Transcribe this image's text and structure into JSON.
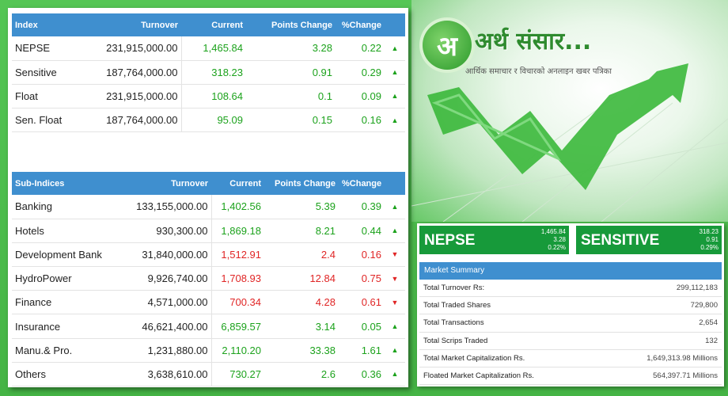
{
  "index_table": {
    "headers": [
      "Index",
      "Turnover",
      "Current",
      "Points Change",
      "%Change"
    ],
    "rows": [
      {
        "name": "NEPSE",
        "turnover": "231,915,000.00",
        "current": "1,465.84",
        "points": "3.28",
        "pct": "0.22",
        "dir": "up"
      },
      {
        "name": "Sensitive",
        "turnover": "187,764,000.00",
        "current": "318.23",
        "points": "0.91",
        "pct": "0.29",
        "dir": "up"
      },
      {
        "name": "Float",
        "turnover": "231,915,000.00",
        "current": "108.64",
        "points": "0.1",
        "pct": "0.09",
        "dir": "up"
      },
      {
        "name": "Sen. Float",
        "turnover": "187,764,000.00",
        "current": "95.09",
        "points": "0.15",
        "pct": "0.16",
        "dir": "up"
      }
    ]
  },
  "sub_table": {
    "headers": [
      "Sub-Indices",
      "Turnover",
      "Current",
      "Points Change",
      "%Change"
    ],
    "rows": [
      {
        "name": "Banking",
        "turnover": "133,155,000.00",
        "current": "1,402.56",
        "points": "5.39",
        "pct": "0.39",
        "dir": "up"
      },
      {
        "name": "Hotels",
        "turnover": "930,300.00",
        "current": "1,869.18",
        "points": "8.21",
        "pct": "0.44",
        "dir": "up"
      },
      {
        "name": "Development Bank",
        "turnover": "31,840,000.00",
        "current": "1,512.91",
        "points": "2.4",
        "pct": "0.16",
        "dir": "down"
      },
      {
        "name": "HydroPower",
        "turnover": "9,926,740.00",
        "current": "1,708.93",
        "points": "12.84",
        "pct": "0.75",
        "dir": "down"
      },
      {
        "name": "Finance",
        "turnover": "4,571,000.00",
        "current": "700.34",
        "points": "4.28",
        "pct": "0.61",
        "dir": "down"
      },
      {
        "name": "Insurance",
        "turnover": "46,621,400.00",
        "current": "6,859.57",
        "points": "3.14",
        "pct": "0.05",
        "dir": "up"
      },
      {
        "name": "Manu.& Pro.",
        "turnover": "1,231,880.00",
        "current": "2,110.20",
        "points": "33.38",
        "pct": "1.61",
        "dir": "up"
      },
      {
        "name": "Others",
        "turnover": "3,638,610.00",
        "current": "730.27",
        "points": "2.6",
        "pct": "0.36",
        "dir": "up"
      }
    ]
  },
  "logo": {
    "glyph": "अ",
    "title": "अर्थ संसार...",
    "tagline": "आर्थिक समाचार र विचारको अनलाइन खबर पत्रिका"
  },
  "tiles": {
    "nepse": {
      "label": "NEPSE",
      "current": "1,465.84",
      "points": "3.28",
      "pct": "0.22%"
    },
    "sensitive": {
      "label": "SENSITIVE",
      "current": "318.23",
      "points": "0.91",
      "pct": "0.29%"
    }
  },
  "market_summary": {
    "title": "Market Summary",
    "rows": [
      {
        "label": "Total Turnover Rs:",
        "value": "299,112,183"
      },
      {
        "label": "Total Traded Shares",
        "value": "729,800"
      },
      {
        "label": "Total Transactions",
        "value": "2,654"
      },
      {
        "label": "Total Scrips Traded",
        "value": "132"
      },
      {
        "label": "Total Market Capitalization Rs.",
        "value": "1,649,313.98 Millions"
      },
      {
        "label": "Floated Market Capitalization Rs.",
        "value": "564,397.71 Millions"
      }
    ]
  },
  "colors": {
    "up": "#1ca21c",
    "down": "#e02525",
    "header": "#3f8fcf",
    "tile": "#179a3a"
  },
  "icons": {
    "up": "triangle-up-icon",
    "down": "triangle-down-icon"
  }
}
